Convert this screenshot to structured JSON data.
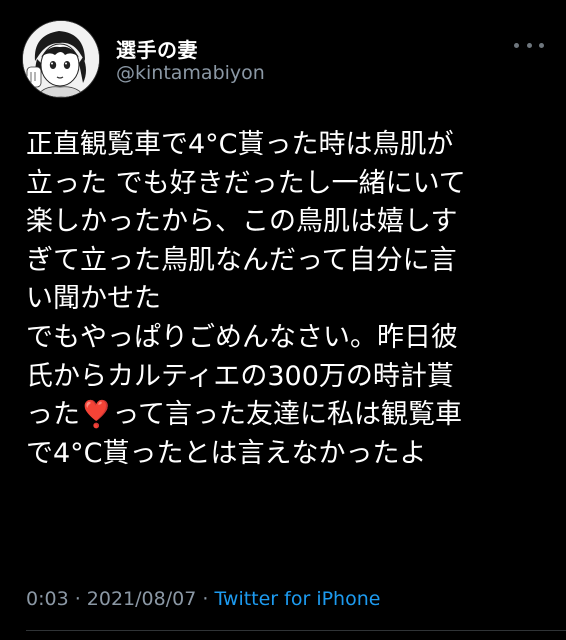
{
  "author": {
    "display_name": "選手の妻",
    "handle": "@kintamabiyon",
    "avatar_icon": "manga-avatar-icon"
  },
  "menu": {
    "more_icon": "more-horizontal-icon"
  },
  "tweet": {
    "lines": [
      "正直観覧車で4°C貰った時は鳥肌が",
      "立った でも好きだったし一緒にいて",
      "楽しかったから、この鳥肌は嬉しす",
      "ぎて立った鳥肌なんだって自分に言",
      "い聞かせた",
      "でもやっぱりごめんなさい。昨日彼",
      "氏からカルティエの300万の時計貰"
    ],
    "line8_before": "った",
    "line8_emoji": "❣️",
    "line8_after": "って言った友達に私は観覧車",
    "line9": "で4°C貰ったとは言えなかったよ"
  },
  "footer": {
    "time": "0:03",
    "separator1": " · ",
    "date": "2021/08/07",
    "separator2": " · ",
    "source": "Twitter for iPhone"
  },
  "colors": {
    "background": "#000000",
    "text": "#ffffff",
    "secondary": "#8b98a5",
    "link": "#1d9bf0"
  }
}
